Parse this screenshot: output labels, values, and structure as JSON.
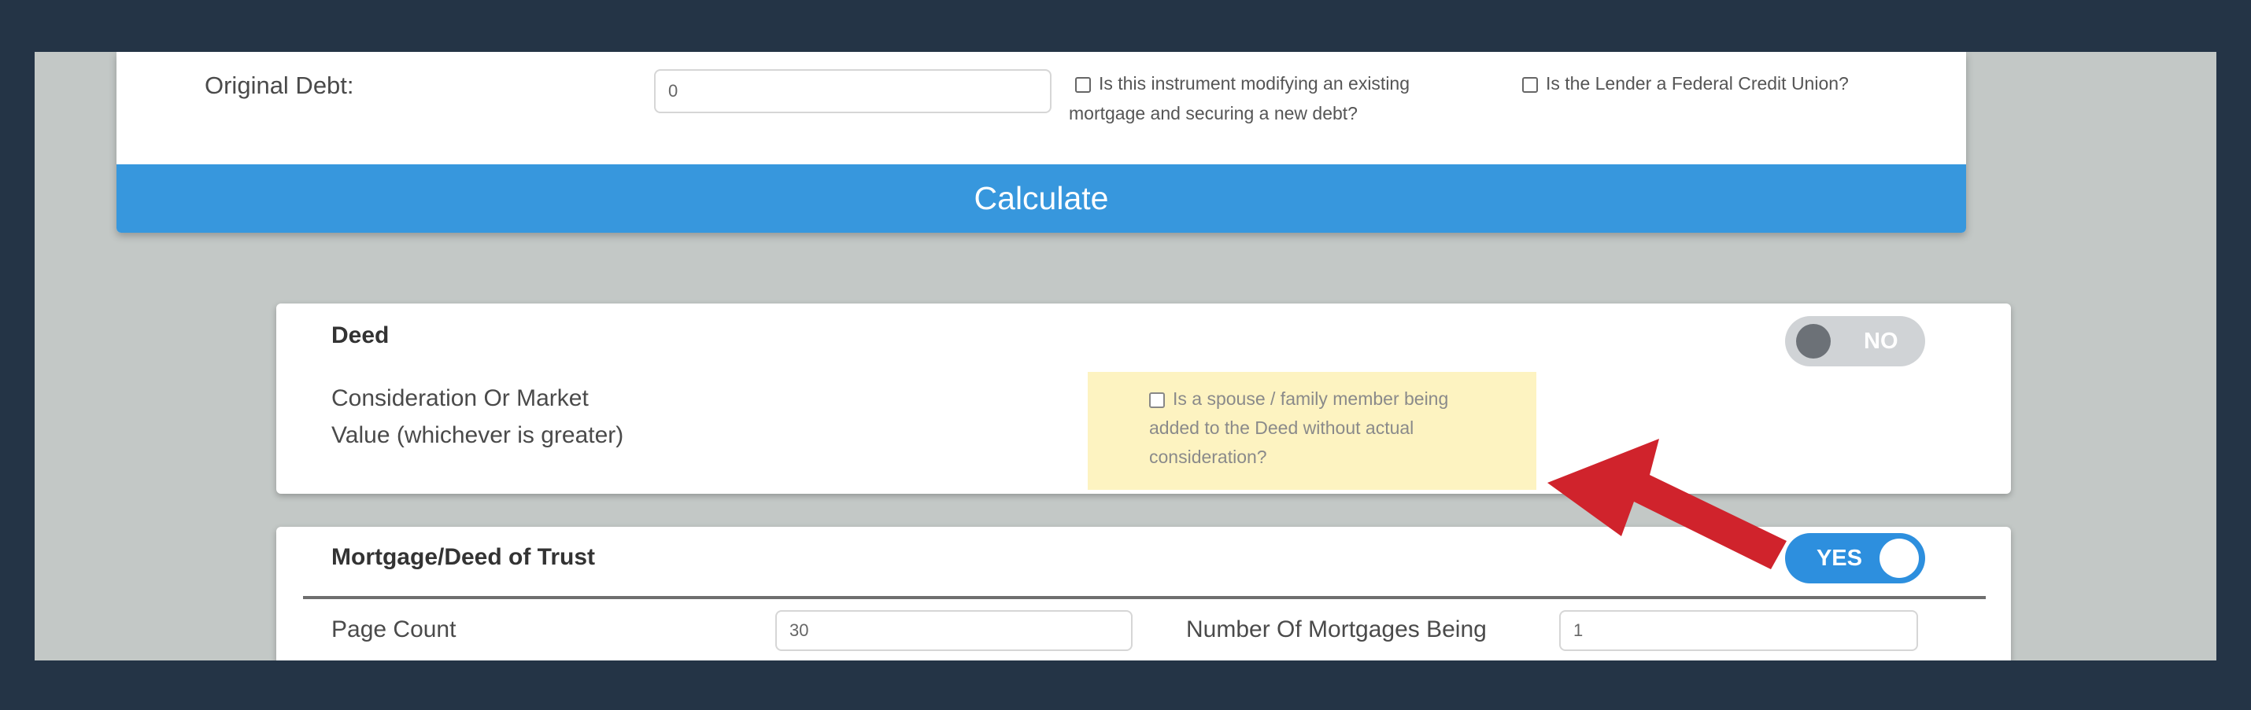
{
  "top": {
    "original_debt_label": "Original Debt:",
    "original_debt_value": "0",
    "modify_line1": "Is this instrument modifying an existing",
    "modify_line2": "mortgage and securing a new debt?",
    "fcu_label": "Is the Lender a Federal Credit Union?",
    "calculate_label": "Calculate"
  },
  "deed": {
    "title": "Deed",
    "toggle_text": "NO",
    "consideration_line1": "Consideration Or Market",
    "consideration_line2": "Value (whichever is greater)",
    "spouse_line1": "Is a spouse / family member being",
    "spouse_line2": "added to the Deed without actual",
    "spouse_line3": "consideration?"
  },
  "mortgage": {
    "title": "Mortgage/Deed of Trust",
    "toggle_text": "YES",
    "page_count_label": "Page Count",
    "page_count_value": "30",
    "num_mortgages_label": "Number Of Mortgages Being",
    "num_mortgages_value": "1"
  },
  "colors": {
    "frame": "#243446",
    "background": "#c3c8c6",
    "accent_blue": "#3797dd",
    "highlight_yellow": "#fdf3c1",
    "arrow_red": "#d0232c"
  },
  "icons": {
    "arrow": "red-arrow-pointer-icon"
  }
}
